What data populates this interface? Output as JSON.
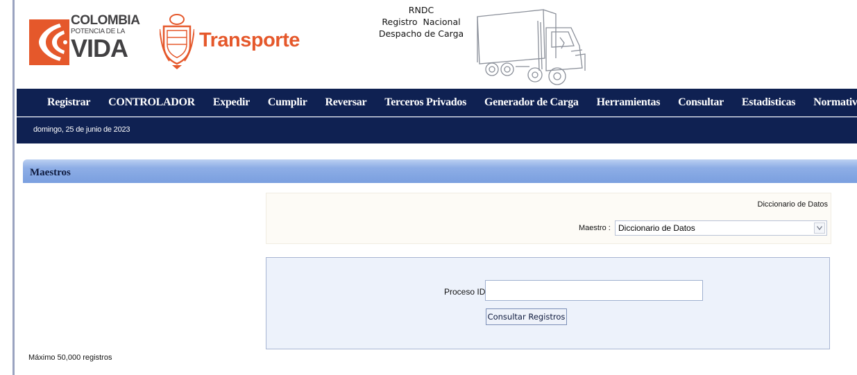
{
  "header": {
    "logo_line1": "COLOMBIA",
    "logo_line2": "POTENCIA DE LA",
    "logo_line3": "VIDA",
    "brand": "Transporte",
    "rndc_title": "RNDC",
    "rndc_line2": "Registro  Nacional",
    "rndc_line3": "Despacho de Carga"
  },
  "nav": {
    "items": [
      "Registrar",
      "CONTROLADOR",
      "Expedir",
      "Cumplir",
      "Reversar",
      "Terceros Privados",
      "Generador de Carga",
      "Herramientas",
      "Consultar",
      "Estadisticas",
      "Normatividad"
    ]
  },
  "date_text": "domingo, 25 de junio de 2023",
  "panel": {
    "title": "Maestros",
    "dictionary_label": "Diccionario de Datos",
    "maestro_label": "Maestro :",
    "maestro_selected": "Diccionario de Datos",
    "proceso_label": "Proceso ID",
    "proceso_value": "",
    "consultar_label": "Consultar Registros",
    "max_records": "Máximo 50,000 registros"
  },
  "colors": {
    "nav_bg": "#0f2152",
    "brand_orange": "#e5582b",
    "panel_header": "#8eaee6",
    "search_bg": "#edf2fb"
  },
  "icons": [
    "colombia-logo-mark",
    "coat-of-arms-icon",
    "truck-icon",
    "chevron-down-icon"
  ]
}
